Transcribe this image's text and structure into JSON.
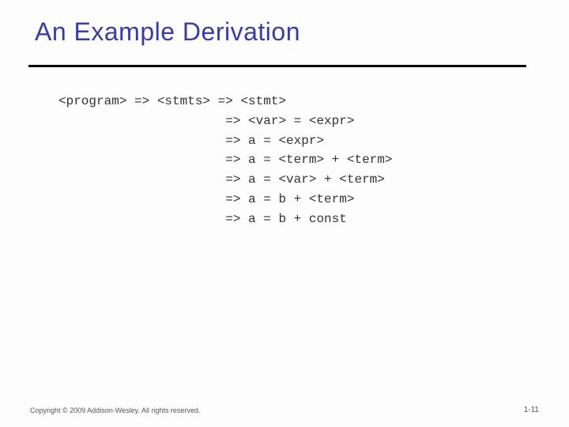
{
  "title": "An Example Derivation",
  "derivation": {
    "line1": "<program> => <stmts> => <stmt>",
    "line2": "                      => <var> = <expr>",
    "line3": "                      => a = <expr>",
    "line4": "                      => a = <term> + <term>",
    "line5": "                      => a = <var> + <term>",
    "line6": "                      => a = b + <term>",
    "line7": "                      => a = b + const"
  },
  "footer": {
    "copyright": "Copyright © 2009 Addison-Wesley. All rights reserved.",
    "pagenum": "1-11"
  }
}
